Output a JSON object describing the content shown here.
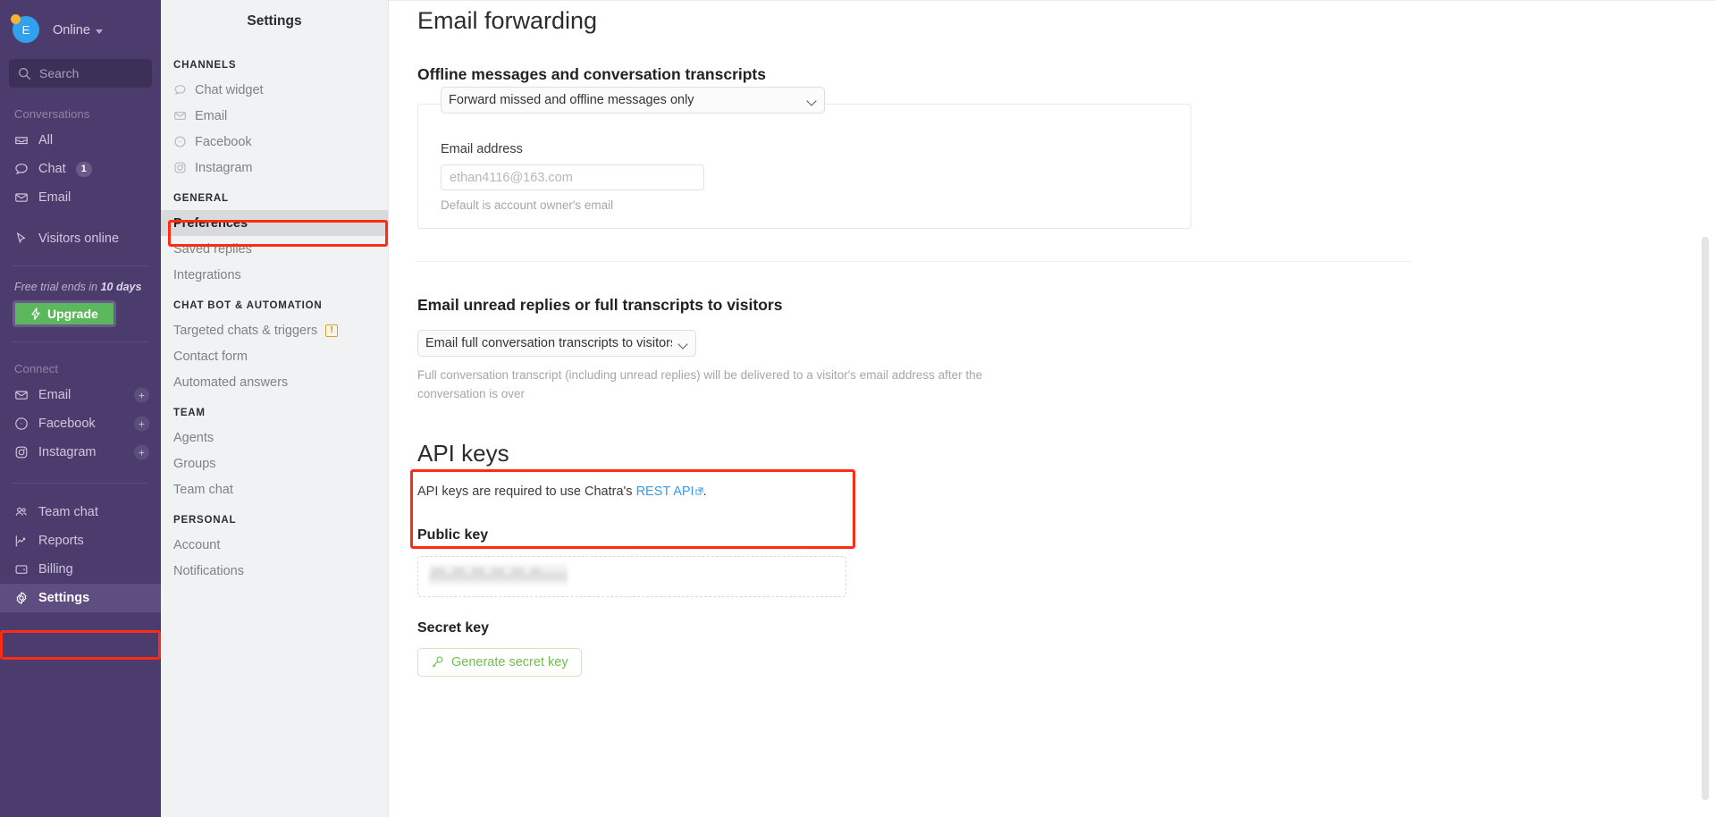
{
  "rail": {
    "profile": {
      "initial": "E",
      "status": "Online",
      "status_color": "#f5b335"
    },
    "search_placeholder": "Search",
    "conversations_label": "Conversations",
    "conversations": [
      {
        "label": "All",
        "icon": "inbox-icon",
        "badge": ""
      },
      {
        "label": "Chat",
        "icon": "chat-bubble-icon",
        "badge": "1"
      },
      {
        "label": "Email",
        "icon": "envelope-icon",
        "badge": ""
      }
    ],
    "visitors": {
      "label": "Visitors online",
      "icon": "cursor-icon"
    },
    "trial_prefix": "Free trial ends in ",
    "trial_days": "10 days",
    "upgrade_label": "Upgrade",
    "upgrade_icon": "lightning-icon",
    "connect_label": "Connect",
    "connect": [
      {
        "label": "Email",
        "icon": "envelope-icon",
        "add": "+"
      },
      {
        "label": "Facebook",
        "icon": "messenger-icon",
        "add": "+"
      },
      {
        "label": "Instagram",
        "icon": "instagram-icon",
        "add": "+"
      }
    ],
    "bottom": [
      {
        "label": "Team chat",
        "icon": "people-icon",
        "active": false
      },
      {
        "label": "Reports",
        "icon": "chart-icon",
        "active": false
      },
      {
        "label": "Billing",
        "icon": "wallet-icon",
        "active": false
      },
      {
        "label": "Settings",
        "icon": "gear-icon",
        "active": true
      }
    ]
  },
  "settings_nav": {
    "title": "Settings",
    "groups": [
      {
        "label": "CHANNELS",
        "items": [
          {
            "label": "Chat widget",
            "icon": "chat-bubble-icon",
            "action": ""
          },
          {
            "label": "Email",
            "icon": "envelope-icon",
            "action": "connect"
          },
          {
            "label": "Facebook",
            "icon": "messenger-icon",
            "action": "connect"
          },
          {
            "label": "Instagram",
            "icon": "instagram-icon",
            "action": "connect"
          }
        ]
      },
      {
        "label": "GENERAL",
        "items": [
          {
            "label": "Preferences",
            "icon": "",
            "action": "",
            "selected": true
          },
          {
            "label": "Saved replies",
            "icon": "",
            "action": ""
          },
          {
            "label": "Integrations",
            "icon": "",
            "action": ""
          }
        ]
      },
      {
        "label": "CHAT BOT & AUTOMATION",
        "items": [
          {
            "label": "Targeted chats & triggers",
            "icon": "",
            "action": "",
            "warn": "!"
          },
          {
            "label": "Contact form",
            "icon": "",
            "action": ""
          },
          {
            "label": "Automated answers",
            "icon": "",
            "action": ""
          }
        ]
      },
      {
        "label": "TEAM",
        "items": [
          {
            "label": "Agents",
            "icon": "",
            "action": ""
          },
          {
            "label": "Groups",
            "icon": "",
            "action": ""
          },
          {
            "label": "Team chat",
            "icon": "",
            "action": ""
          }
        ]
      },
      {
        "label": "PERSONAL",
        "items": [
          {
            "label": "Account",
            "icon": "",
            "action": ""
          },
          {
            "label": "Notifications",
            "icon": "",
            "action": ""
          }
        ]
      }
    ]
  },
  "main": {
    "page_title": "Email forwarding",
    "offline": {
      "heading": "Offline messages and conversation transcripts",
      "forward_select_value": "Forward missed and offline messages only",
      "forward_select_options": [
        "Forward missed and offline messages only"
      ],
      "email_label": "Email address",
      "email_placeholder": "ethan4116@163.com",
      "email_value": "",
      "email_hint": "Default is account owner's email"
    },
    "unread": {
      "heading": "Email unread replies or full transcripts to visitors",
      "select_value": "Email full conversation transcripts to visitors",
      "select_options": [
        "Email full conversation transcripts to visitors"
      ],
      "hint": "Full conversation transcript (including unread replies) will be delivered to a visitor's email address after the conversation is over"
    },
    "api": {
      "heading": "API keys",
      "desc_prefix": "API keys are required to use Chatra's ",
      "desc_link": "REST API",
      "desc_suffix": ".",
      "public_key_label": "Public key",
      "public_key_value": "",
      "secret_key_label": "Secret key",
      "generate_label": "Generate secret key",
      "generate_icon": "key-icon"
    }
  },
  "highlights": {
    "color": "#fd2c13",
    "regions": [
      "preferences-nav-item",
      "settings-rail-item",
      "public-key-block"
    ]
  }
}
